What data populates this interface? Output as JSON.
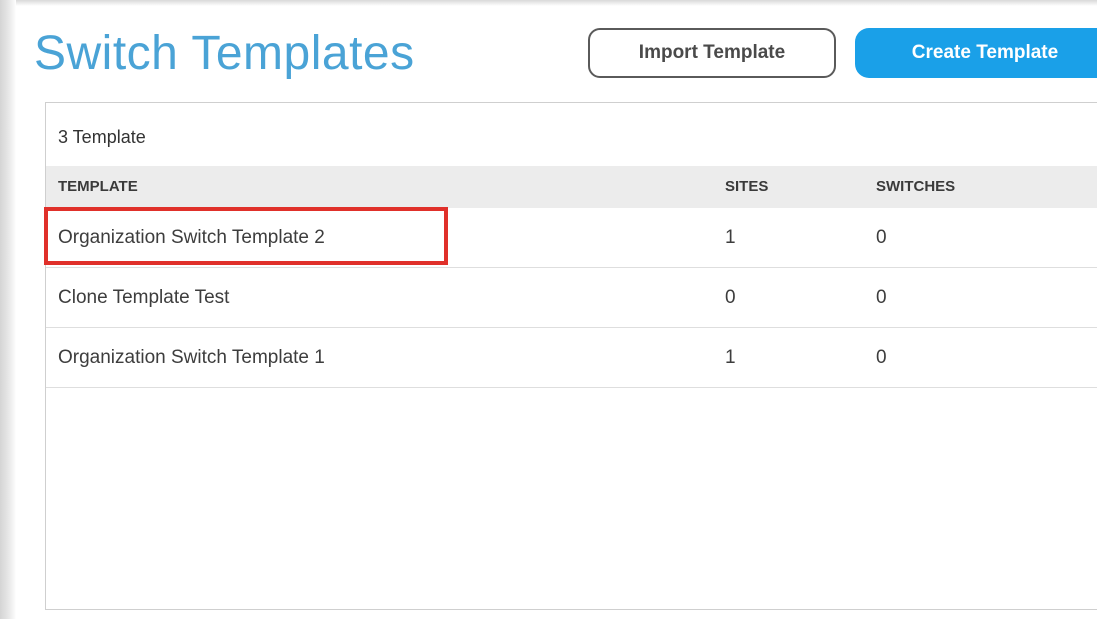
{
  "page": {
    "title": "Switch Templates"
  },
  "toolbar": {
    "import_label": "Import Template",
    "create_label": "Create Template",
    "create_color": "#1aa0e8"
  },
  "list": {
    "count_label": "3 Template",
    "columns": [
      "TEMPLATE",
      "SITES",
      "SWITCHES"
    ],
    "rows": [
      {
        "template": "Organization Switch Template 2",
        "sites": "1",
        "switches": "0",
        "highlighted": true
      },
      {
        "template": "Clone Template Test",
        "sites": "0",
        "switches": "0",
        "highlighted": false
      },
      {
        "template": "Organization Switch Template 1",
        "sites": "1",
        "switches": "0",
        "highlighted": false
      }
    ]
  },
  "colors": {
    "title": "#4aa3d6",
    "highlight_border": "#e0302a"
  }
}
